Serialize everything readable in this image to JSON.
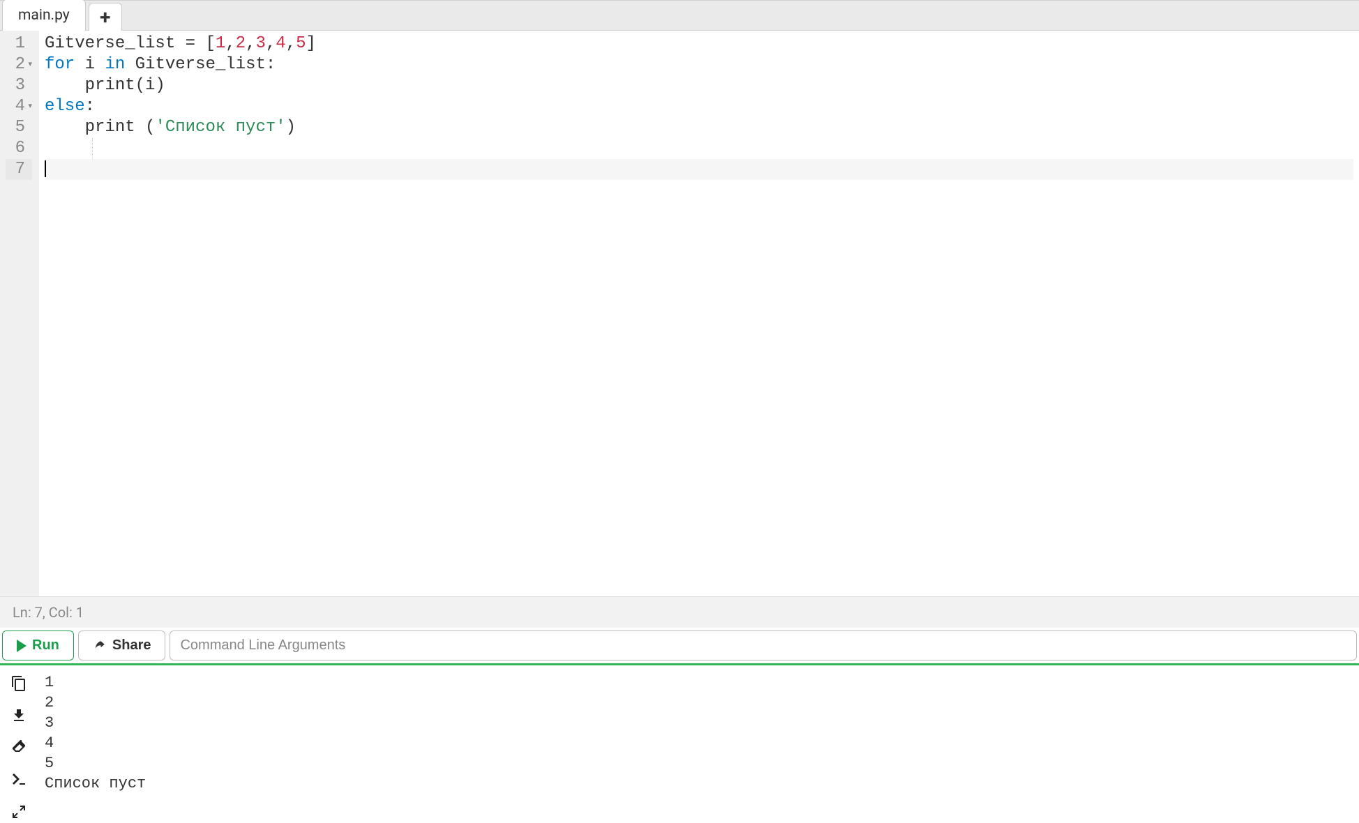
{
  "tabs": {
    "active": "main.py"
  },
  "editor": {
    "lines": [
      {
        "num": "1",
        "fold": "",
        "tokens": [
          {
            "t": "Gitverse_list ",
            "c": ""
          },
          {
            "t": "=",
            "c": "tok-op"
          },
          {
            "t": " [",
            "c": ""
          },
          {
            "t": "1",
            "c": "tok-num"
          },
          {
            "t": ",",
            "c": ""
          },
          {
            "t": "2",
            "c": "tok-num"
          },
          {
            "t": ",",
            "c": ""
          },
          {
            "t": "3",
            "c": "tok-num"
          },
          {
            "t": ",",
            "c": ""
          },
          {
            "t": "4",
            "c": "tok-num"
          },
          {
            "t": ",",
            "c": ""
          },
          {
            "t": "5",
            "c": "tok-num"
          },
          {
            "t": "]",
            "c": ""
          }
        ]
      },
      {
        "num": "2",
        "fold": "▾",
        "tokens": [
          {
            "t": "for",
            "c": "tok-kw"
          },
          {
            "t": " i ",
            "c": ""
          },
          {
            "t": "in",
            "c": "tok-kw"
          },
          {
            "t": " Gitverse_list:",
            "c": ""
          }
        ]
      },
      {
        "num": "3",
        "fold": "",
        "tokens": [
          {
            "t": "    ",
            "c": ""
          },
          {
            "t": "print",
            "c": "tok-fn"
          },
          {
            "t": "(i)",
            "c": ""
          }
        ]
      },
      {
        "num": "4",
        "fold": "▾",
        "tokens": [
          {
            "t": "else",
            "c": "tok-kw"
          },
          {
            "t": ":",
            "c": ""
          }
        ]
      },
      {
        "num": "5",
        "fold": "",
        "tokens": [
          {
            "t": "    ",
            "c": ""
          },
          {
            "t": "print",
            "c": "tok-fn"
          },
          {
            "t": " (",
            "c": ""
          },
          {
            "t": "'Список пуст'",
            "c": "tok-str"
          },
          {
            "t": ")",
            "c": ""
          }
        ]
      },
      {
        "num": "6",
        "fold": "",
        "tokens": [
          {
            "t": "    ",
            "c": ""
          }
        ]
      },
      {
        "num": "7",
        "fold": "",
        "tokens": [],
        "active": true,
        "cursor": true
      }
    ]
  },
  "status": {
    "text": "Ln: 7,  Col: 1"
  },
  "toolbar": {
    "run_label": "Run",
    "share_label": "Share",
    "cli_placeholder": "Command Line Arguments"
  },
  "output": {
    "lines": [
      "1",
      "2",
      "3",
      "4",
      "5",
      "Список пуст"
    ]
  }
}
